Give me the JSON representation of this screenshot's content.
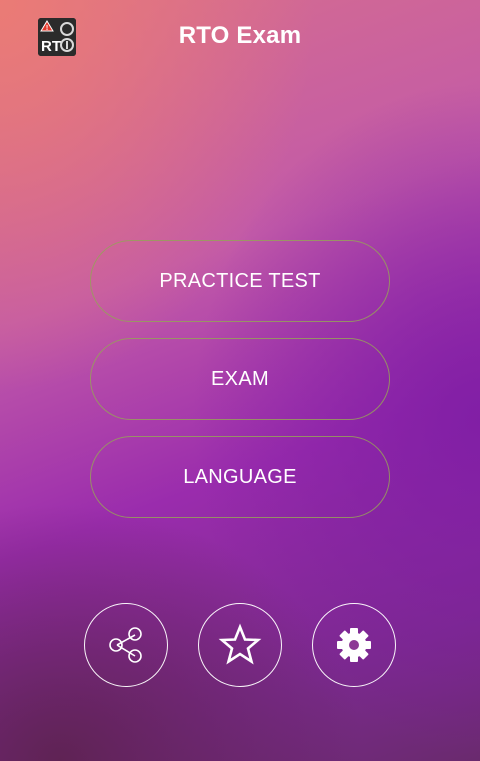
{
  "header": {
    "title": "RTO Exam",
    "logo_text": "RTO",
    "logo_icon": "rto-app-logo"
  },
  "menu": {
    "items": [
      {
        "label": "PRACTICE TEST"
      },
      {
        "label": "EXAM"
      },
      {
        "label": "LANGUAGE"
      }
    ]
  },
  "bottom_actions": [
    {
      "icon": "share-icon"
    },
    {
      "icon": "star-icon"
    },
    {
      "icon": "gear-icon"
    }
  ],
  "colors": {
    "text": "#ffffff",
    "button_border": "#969f5a",
    "gradient_top_left": "#ec7c74",
    "gradient_mid": "#9a2cad",
    "gradient_bottom": "#6a2a6e"
  }
}
